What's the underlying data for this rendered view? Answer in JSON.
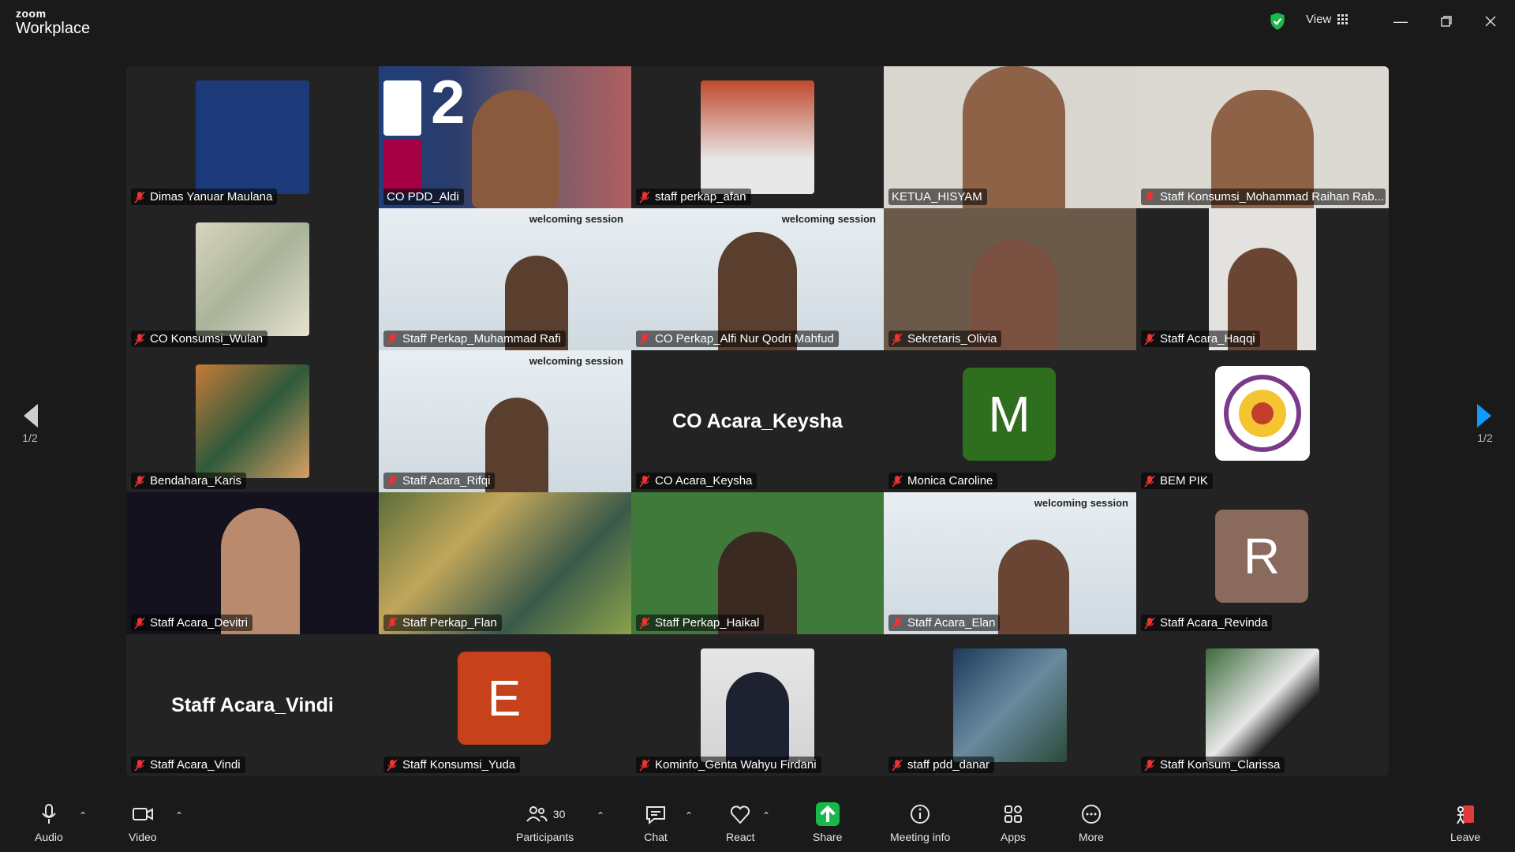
{
  "app": {
    "brand_top": "zoom",
    "brand_bottom": "Workplace",
    "view_label": "View"
  },
  "pager": {
    "left": "1/2",
    "right": "1/2"
  },
  "tiles": [
    {
      "name": "Dimas Yanuar Maulana",
      "muted": true,
      "bg": "#1c3a7a"
    },
    {
      "name": "CO PDD_Aldi",
      "muted": false,
      "active": true
    },
    {
      "name": "staff perkap_afan",
      "muted": true
    },
    {
      "name": "KETUA_HISYAM",
      "muted": false
    },
    {
      "name": "Staff Konsumsi_Mohammad Raihan Rab...",
      "muted": true
    },
    {
      "name": "CO Konsumsi_Wulan",
      "muted": true
    },
    {
      "name": "Staff Perkap_Muhammad Rafi",
      "muted": true
    },
    {
      "name": "CO Perkap_Alfi Nur Qodri Mahfud",
      "muted": true
    },
    {
      "name": "Sekretaris_Olivia",
      "muted": true
    },
    {
      "name": "Staff Acara_Haqqi",
      "muted": true
    },
    {
      "name": "Bendahara_Karis",
      "muted": true
    },
    {
      "name": "Staff Acara_Rifqi",
      "muted": true
    },
    {
      "name": "CO Acara_Keysha",
      "muted": true,
      "bigname": "CO Acara_Keysha"
    },
    {
      "name": "Monica Caroline",
      "muted": true,
      "letter": "M",
      "letter_color": "#2f6e1e"
    },
    {
      "name": "BEM PIK",
      "muted": true
    },
    {
      "name": "Staff Acara_Devitri",
      "muted": true
    },
    {
      "name": "Staff Perkap_Flan",
      "muted": true
    },
    {
      "name": "Staff Perkap_Haikal",
      "muted": true
    },
    {
      "name": "Staff Acara_Elan",
      "muted": true
    },
    {
      "name": "Staff Acara_Revinda",
      "muted": true,
      "letter": "R",
      "letter_color": "#8a6a5c"
    },
    {
      "name": "Staff Acara_Vindi",
      "muted": true,
      "bigname": "Staff Acara_Vindi"
    },
    {
      "name": "Staff Konsumsi_Yuda",
      "muted": true,
      "letter": "E",
      "letter_color": "#c7421a"
    },
    {
      "name": "Kominfo_Genta Wahyu Firdani",
      "muted": true
    },
    {
      "name": "staff pdd_danar",
      "muted": true
    },
    {
      "name": "Staff Konsum_Clarissa",
      "muted": true
    }
  ],
  "toolbar": {
    "audio": "Audio",
    "video": "Video",
    "participants": "Participants",
    "participants_count": "30",
    "chat": "Chat",
    "react": "React",
    "share": "Share",
    "meeting_info": "Meeting info",
    "apps": "Apps",
    "more": "More",
    "leave": "Leave"
  },
  "colors": {
    "accent_green": "#1ed67b",
    "share_green": "#19b84a",
    "shield_green": "#19b84a",
    "nav_arrow_blue": "#0e9cff"
  },
  "welcoming_text": "welcoming session"
}
